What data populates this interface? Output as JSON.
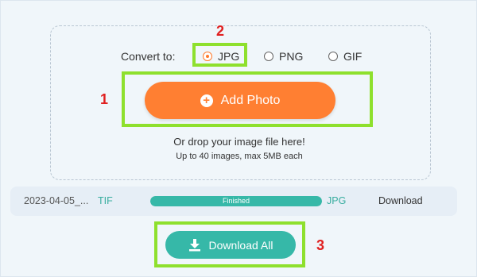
{
  "converter": {
    "convert_label": "Convert to:",
    "formats": [
      {
        "label": "JPG",
        "selected": true
      },
      {
        "label": "PNG",
        "selected": false
      },
      {
        "label": "GIF",
        "selected": false
      }
    ],
    "add_photo_label": "Add Photo",
    "drop_text": "Or drop your image file here!",
    "limit_text": "Up to 40 images, max 5MB each"
  },
  "file_row": {
    "name": "2023-04-05_...",
    "from_format": "TIF",
    "progress_label": "Finished",
    "progress": 1.0,
    "to_format": "JPG",
    "download_label": "Download"
  },
  "download_all_label": "Download All",
  "annotations": {
    "step1": "1",
    "step2": "2",
    "step3": "3"
  },
  "colors": {
    "accent_orange": "#ff7f32",
    "teal": "#36b8a8",
    "highlight_green": "#8ee02d",
    "step_red": "#e02020",
    "background": "#f0f6fa"
  }
}
